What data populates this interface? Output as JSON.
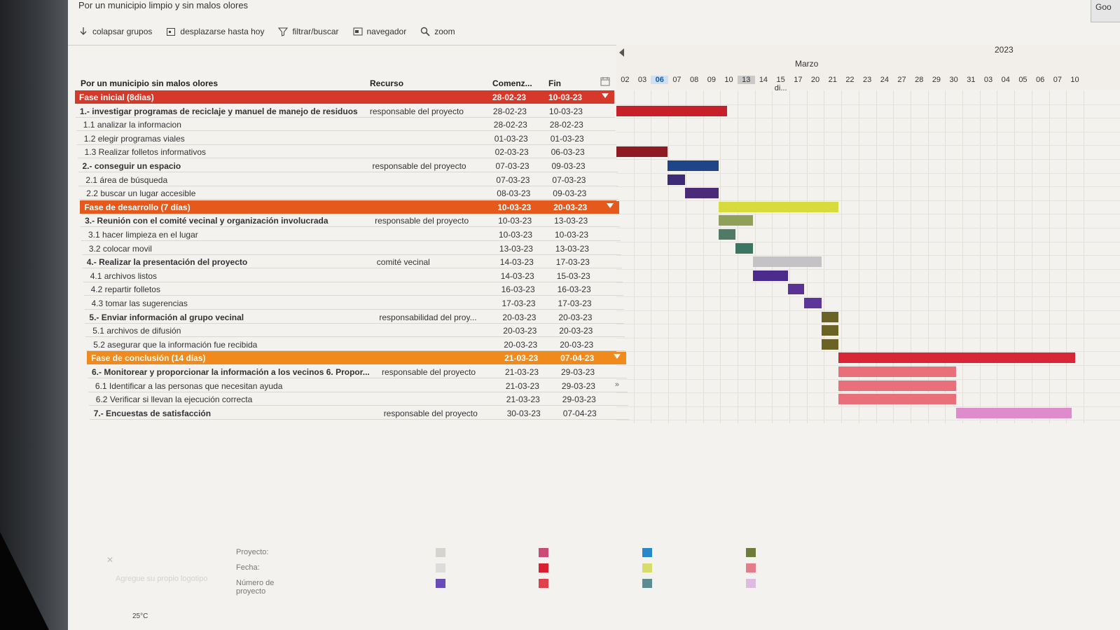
{
  "app": {
    "title": "Por un municipio limpio y sin malos olores",
    "corner_button": "Goo"
  },
  "toolbar": [
    {
      "label": "colapsar grupos",
      "icon": "collapse-icon"
    },
    {
      "label": "desplazarse hasta hoy",
      "icon": "calendar-today-icon"
    },
    {
      "label": "filtrar/buscar",
      "icon": "filter-icon"
    },
    {
      "label": "navegador",
      "icon": "navigator-icon"
    },
    {
      "label": "zoom",
      "icon": "zoom-icon"
    }
  ],
  "grid": {
    "headers": {
      "name": "Por un municipio sin malos olores",
      "resource": "Recurso",
      "start": "Comenz...",
      "end": "Fin"
    },
    "rows": [
      {
        "type": "phase",
        "name": "Fase inicial (8dias)",
        "resource": "",
        "start": "28-02-23",
        "end": "10-03-23",
        "color": "#d6392a"
      },
      {
        "type": "task",
        "name": "1.- investigar programas de reciclaje y manuel de manejo de residuos",
        "resource": "responsable del proyecto",
        "start": "28-02-23",
        "end": "10-03-23"
      },
      {
        "type": "sub",
        "name": "1.1 analizar la informacion",
        "resource": "",
        "start": "28-02-23",
        "end": "28-02-23"
      },
      {
        "type": "sub",
        "name": "1.2 elegir programas viales",
        "resource": "",
        "start": "01-03-23",
        "end": "01-03-23"
      },
      {
        "type": "sub",
        "name": "1.3 Realizar folletos informativos",
        "resource": "",
        "start": "02-03-23",
        "end": "06-03-23"
      },
      {
        "type": "task",
        "name": "2.- conseguir un espacio",
        "resource": "responsable del proyecto",
        "start": "07-03-23",
        "end": "09-03-23"
      },
      {
        "type": "sub",
        "name": "2.1 área de búsqueda",
        "resource": "",
        "start": "07-03-23",
        "end": "07-03-23"
      },
      {
        "type": "sub",
        "name": "2.2 buscar un lugar accesible",
        "resource": "",
        "start": "08-03-23",
        "end": "09-03-23"
      },
      {
        "type": "phase",
        "name": "Fase de desarrollo (7 días)",
        "resource": "",
        "start": "10-03-23",
        "end": "20-03-23",
        "color": "#e55a1c"
      },
      {
        "type": "task",
        "name": "3.- Reunión con el comité vecinal y organización involucrada",
        "resource": "responsable del proyecto",
        "start": "10-03-23",
        "end": "13-03-23"
      },
      {
        "type": "sub",
        "name": "3.1 hacer limpieza en el lugar",
        "resource": "",
        "start": "10-03-23",
        "end": "10-03-23"
      },
      {
        "type": "sub",
        "name": "3.2 colocar movil",
        "resource": "",
        "start": "13-03-23",
        "end": "13-03-23"
      },
      {
        "type": "task",
        "name": "4.- Realizar la presentación del proyecto",
        "resource": "comité vecinal",
        "start": "14-03-23",
        "end": "17-03-23"
      },
      {
        "type": "sub",
        "name": "4.1 archivos listos",
        "resource": "",
        "start": "14-03-23",
        "end": "15-03-23"
      },
      {
        "type": "sub",
        "name": "4.2 repartir folletos",
        "resource": "",
        "start": "16-03-23",
        "end": "16-03-23"
      },
      {
        "type": "sub",
        "name": "4.3 tomar las sugerencias",
        "resource": "",
        "start": "17-03-23",
        "end": "17-03-23"
      },
      {
        "type": "task",
        "name": "5.- Enviar información al grupo vecinal",
        "resource": "responsabilidad del proy...",
        "start": "20-03-23",
        "end": "20-03-23"
      },
      {
        "type": "sub",
        "name": "5.1 archivos de difusión",
        "resource": "",
        "start": "20-03-23",
        "end": "20-03-23"
      },
      {
        "type": "sub",
        "name": "5.2 asegurar que la información fue recibida",
        "resource": "",
        "start": "20-03-23",
        "end": "20-03-23"
      },
      {
        "type": "phase",
        "name": "Fase de conclusión (14 días)",
        "resource": "",
        "start": "21-03-23",
        "end": "07-04-23",
        "color": "#f08a1c"
      },
      {
        "type": "task",
        "name": "6.- Monitorear y proporcionar la información a los vecinos 6. Propor...",
        "resource": "responsable del proyecto",
        "start": "21-03-23",
        "end": "29-03-23"
      },
      {
        "type": "sub",
        "name": "6.1 Identificar a las personas que necesitan ayuda",
        "resource": "",
        "start": "21-03-23",
        "end": "29-03-23"
      },
      {
        "type": "sub",
        "name": "6.2 Verificar si llevan la ejecución correcta",
        "resource": "",
        "start": "21-03-23",
        "end": "29-03-23"
      },
      {
        "type": "task",
        "name": "7.- Encuestas de satisfacción",
        "resource": "responsable del proyecto",
        "start": "30-03-23",
        "end": "07-04-23"
      }
    ]
  },
  "timeline": {
    "year": "2023",
    "month": "Marzo",
    "today_label": "06",
    "selected_label": "13",
    "days": [
      "02",
      "03",
      "06",
      "07",
      "08",
      "09",
      "10",
      "13",
      "14",
      "15 di...",
      "17",
      "20",
      "21",
      "22",
      "23",
      "24",
      "27",
      "28",
      "29",
      "30",
      "31",
      "03",
      "04",
      "05",
      "06",
      "07",
      "10"
    ]
  },
  "bars": [
    {
      "row": 1,
      "from": 0,
      "to": 6.4,
      "color": "#c8202a"
    },
    {
      "row": 4,
      "from": 0,
      "to": 2.95,
      "color": "#8e1a22"
    },
    {
      "row": 5,
      "from": 2.95,
      "to": 5.9,
      "color": "#1d4587"
    },
    {
      "row": 6,
      "from": 2.95,
      "to": 3.95,
      "color": "#3d2b78"
    },
    {
      "row": 7,
      "from": 3.95,
      "to": 5.9,
      "color": "#4b2a7a"
    },
    {
      "row": 8,
      "from": 5.9,
      "to": 12.85,
      "color": "#d7dc3c"
    },
    {
      "row": 9,
      "from": 5.9,
      "to": 7.9,
      "color": "#8ea05a"
    },
    {
      "row": 10,
      "from": 5.9,
      "to": 6.9,
      "color": "#4e7a66"
    },
    {
      "row": 11,
      "from": 6.9,
      "to": 7.9,
      "color": "#3d7563"
    },
    {
      "row": 12,
      "from": 7.9,
      "to": 11.85,
      "color": "#c4c2c4"
    },
    {
      "row": 13,
      "from": 7.9,
      "to": 9.9,
      "color": "#4b2c8c"
    },
    {
      "row": 14,
      "from": 9.9,
      "to": 10.85,
      "color": "#5a3296"
    },
    {
      "row": 15,
      "from": 10.85,
      "to": 11.85,
      "color": "#5b3598"
    },
    {
      "row": 16,
      "from": 11.85,
      "to": 12.85,
      "color": "#6b6326"
    },
    {
      "row": 17,
      "from": 11.85,
      "to": 12.85,
      "color": "#6b6326"
    },
    {
      "row": 18,
      "from": 11.85,
      "to": 12.85,
      "color": "#6b6326"
    },
    {
      "row": 19,
      "from": 12.85,
      "to": 26.5,
      "color": "#d82636"
    },
    {
      "row": 20,
      "from": 12.85,
      "to": 19.65,
      "color": "#e9707a"
    },
    {
      "row": 21,
      "from": 12.85,
      "to": 19.65,
      "color": "#e9707a"
    },
    {
      "row": 22,
      "from": 12.85,
      "to": 19.65,
      "color": "#e9707a"
    },
    {
      "row": 23,
      "from": 19.65,
      "to": 26.3,
      "color": "#df8ccd"
    }
  ],
  "legend": {
    "labels": [
      "Proyecto:",
      "Fecha:",
      "Número de proyecto"
    ],
    "placeholder": "Agregue su propio logotipo",
    "swatches": [
      [
        "#d5d5cd",
        "#cc4a78",
        "#2b88c8",
        "#6f7b3a"
      ],
      [
        "#dcdcdc",
        "#d82030",
        "#d8dc6c",
        "#e47c8c"
      ],
      [
        "#6a4cb8",
        "#e0404c",
        "#5b8c92",
        "#dcbde0"
      ]
    ]
  },
  "status": {
    "temperature": "25°C"
  }
}
